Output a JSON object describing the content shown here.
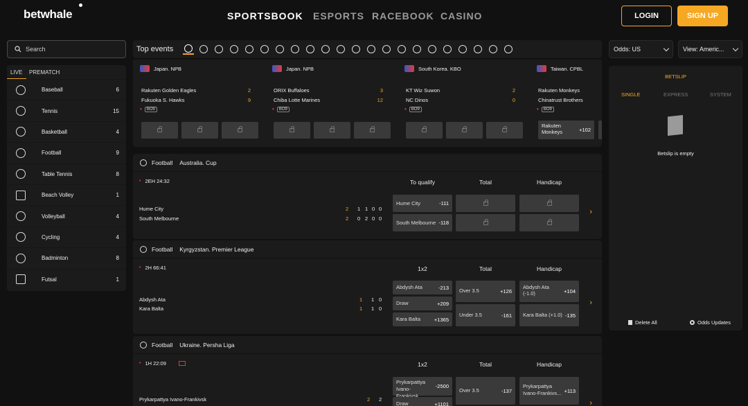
{
  "header": {
    "logo": "betwhale",
    "nav": [
      "SPORTSBOOK",
      "ESPORTS",
      "RACEBOOK",
      "CASINO"
    ],
    "login": "LOGIN",
    "signup": "SIGN UP"
  },
  "search": {
    "placeholder": "Search"
  },
  "sidebar": {
    "tabs": [
      "LIVE",
      "PREMATCH"
    ],
    "items": [
      {
        "label": "Baseball",
        "count": "6",
        "icon": "baseball-icon"
      },
      {
        "label": "Tennis",
        "count": "15",
        "icon": "tennis-icon"
      },
      {
        "label": "Basketball",
        "count": "4",
        "icon": "basketball-icon"
      },
      {
        "label": "Football",
        "count": "9",
        "icon": "football-icon"
      },
      {
        "label": "Table Tennis",
        "count": "8",
        "icon": "table-tennis-icon"
      },
      {
        "label": "Beach Volley",
        "count": "1",
        "icon": "beach-volley-icon"
      },
      {
        "label": "Volleyball",
        "count": "4",
        "icon": "volleyball-icon"
      },
      {
        "label": "Cycling",
        "count": "4",
        "icon": "cycling-icon"
      },
      {
        "label": "Badminton",
        "count": "8",
        "icon": "badminton-icon"
      },
      {
        "label": "Futsal",
        "count": "1",
        "icon": "futsal-icon"
      }
    ]
  },
  "top_events": {
    "title": "Top events",
    "cards": [
      {
        "league": "Japan. NPB",
        "team1": "Rakuten Golden Eagles",
        "team2": "Fukuoka S. Hawks",
        "score1": "2",
        "score2": "9",
        "badge": "BO9"
      },
      {
        "league": "Japan. NPB",
        "team1": "ORIX Buffaloes",
        "team2": "Chiba Lotte Marines",
        "score1": "3",
        "score2": "12",
        "badge": "BO9"
      },
      {
        "league": "South Korea. KBO",
        "team1": "KT Wiz Suwon",
        "team2": "NC Dinos",
        "score1": "2",
        "score2": "0",
        "badge": "BO9"
      },
      {
        "league": "Taiwan. CPBL",
        "team1": "Rakuten Monkeys",
        "team2": "Chinatrust Brothers",
        "score1": "",
        "score2": "",
        "badge": "BO9",
        "odd_name": "Rakuten Monkeys",
        "odd_value": "+102"
      }
    ]
  },
  "sections": [
    {
      "sport": "Football",
      "league": "Australia. Cup",
      "time": "2EH  24:32",
      "team1": "Hume City",
      "team2": "South Melbourne",
      "scores1": [
        "2",
        "1",
        "1",
        "0",
        "0"
      ],
      "scores2": [
        "2",
        "0",
        "2",
        "0",
        "0"
      ],
      "cols": [
        "To qualify",
        "Total",
        "Handicap"
      ],
      "odds": [
        {
          "name": "Hume City",
          "value": "-111"
        },
        {
          "name": "South Melbourne",
          "value": "-118"
        }
      ]
    },
    {
      "sport": "Football",
      "league": "Kyrgyzstan. Premier League",
      "time": "2H  66:41",
      "team1": "Abdysh Ata",
      "team2": "Kara Balta",
      "scores1": [
        "1",
        "1",
        "0"
      ],
      "scores2": [
        "1",
        "1",
        "0"
      ],
      "cols": [
        "1x2",
        "Total",
        "Handicap"
      ],
      "odds": [
        {
          "name": "Abdysh Ata",
          "value": "-213"
        },
        {
          "name": "Draw",
          "value": "+209"
        },
        {
          "name": "Kara Balta",
          "value": "+1365"
        },
        {
          "name": "Over 3.5",
          "value": "+126"
        },
        {
          "name": "Under 3.5",
          "value": "-161"
        },
        {
          "name": "Abdysh Ata (-1.0)",
          "value": "+104"
        },
        {
          "name": "Kara Balta (+1.0)",
          "value": "-135"
        }
      ]
    },
    {
      "sport": "Football",
      "league": "Ukraine. Persha Liga",
      "time": "1H  22:09",
      "team1": "Prykarpattya Ivano-Frankivsk",
      "team2": "",
      "scores1": [
        "2",
        "2"
      ],
      "cols": [
        "1x2",
        "Total",
        "Handicap"
      ],
      "odds": [
        {
          "name": "Prykarpattya Ivano-Frankivsk",
          "value": "-2500"
        },
        {
          "name": "Draw",
          "value": "+1101"
        },
        {
          "name": "Over 3.5",
          "value": "-137"
        },
        {
          "name": "Prykarpattya Ivano-Frankivs...",
          "value": "+113"
        }
      ]
    }
  ],
  "right": {
    "odds_label": "Odds:  US",
    "view_label": "View:  Americ...",
    "betslip": "BETSLIP",
    "tabs": [
      "SINGLE",
      "EXPRESS",
      "SYSTEM"
    ],
    "empty": "Betslip is empty",
    "delete_all": "Delete All",
    "odds_updates": "Odds Updates"
  },
  "colors": {
    "accent": "#f6a823",
    "live": "#e23a3a",
    "panel": "#1b1b1b",
    "background": "#111111"
  }
}
